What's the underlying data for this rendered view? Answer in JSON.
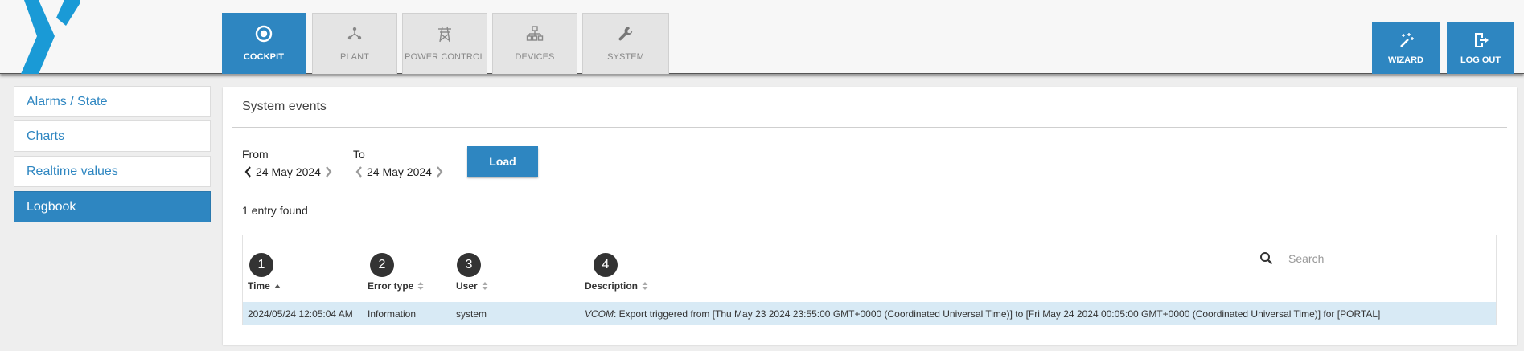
{
  "nav": {
    "tabs": [
      {
        "label": "COCKPIT",
        "icon": "target-icon",
        "active": true
      },
      {
        "label": "PLANT",
        "icon": "network-icon",
        "active": false
      },
      {
        "label": "POWER CONTROL",
        "icon": "power-tower-icon",
        "active": false
      },
      {
        "label": "DEVICES",
        "icon": "hierarchy-icon",
        "active": false
      },
      {
        "label": "SYSTEM",
        "icon": "wrench-icon",
        "active": false
      }
    ],
    "wizard_label": "WIZARD",
    "logout_label": "LOG OUT"
  },
  "sidebar": {
    "items": [
      {
        "label": "Alarms / State",
        "active": false
      },
      {
        "label": "Charts",
        "active": false
      },
      {
        "label": "Realtime values",
        "active": false
      },
      {
        "label": "Logbook",
        "active": true
      }
    ]
  },
  "main": {
    "title": "System events",
    "from_label": "From",
    "from_date": "24 May 2024",
    "to_label": "To",
    "to_date": "24 May 2024",
    "load_label": "Load",
    "entry_count": "1 entry found",
    "search_placeholder": "Search",
    "callouts": [
      "1",
      "2",
      "3",
      "4"
    ],
    "columns": [
      "Time",
      "Error type",
      "User",
      "Description"
    ],
    "rows": [
      {
        "time": "2024/05/24 12:05:04 AM",
        "error_type": "Information",
        "user": "system",
        "desc_prefix": "VCOM",
        "desc_text": ": Export triggered from [Thu May 23 2024 23:55:00 GMT+0000 (Coordinated Universal Time)] to [Fri May 24 2024 00:05:00 GMT+0000 (Coordinated Universal Time)] for [PORTAL]"
      }
    ]
  },
  "colors": {
    "accent": "#2e86c1",
    "row_highlight": "#d8eaf5",
    "callout": "#333333"
  }
}
